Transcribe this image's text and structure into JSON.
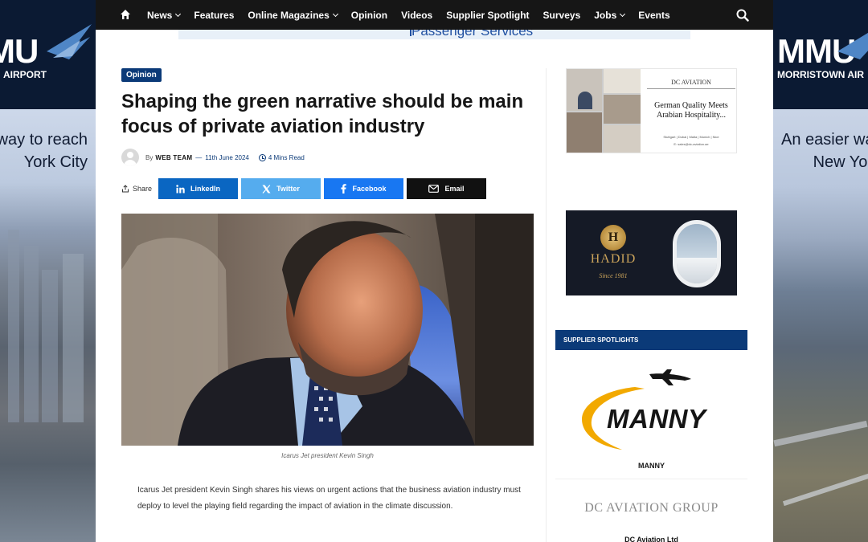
{
  "nav": {
    "items": [
      {
        "label": "News",
        "has_dropdown": true
      },
      {
        "label": "Features",
        "has_dropdown": false
      },
      {
        "label": "Online Magazines",
        "has_dropdown": true
      },
      {
        "label": "Opinion",
        "has_dropdown": false
      },
      {
        "label": "Videos",
        "has_dropdown": false
      },
      {
        "label": "Supplier Spotlight",
        "has_dropdown": false
      },
      {
        "label": "Surveys",
        "has_dropdown": false
      },
      {
        "label": "Jobs",
        "has_dropdown": true
      },
      {
        "label": "Events",
        "has_dropdown": false
      }
    ],
    "home_icon": "home-icon",
    "search_icon": "search-icon"
  },
  "header_banner": {
    "text": "Passenger Services"
  },
  "skins": {
    "left": {
      "brand": "MU",
      "sub": "AIRPORT",
      "tagline_1": "way to reach",
      "tagline_2": "York City"
    },
    "right": {
      "brand": "MMU",
      "sub": "MORRISTOWN AIR",
      "tagline_1": "An easier wa",
      "tagline_2": "New Yor"
    }
  },
  "article": {
    "category": "Opinion",
    "title": "Shaping the green narrative should be main focus of private aviation industry",
    "by": "By",
    "author": "WEB TEAM",
    "separator": "—",
    "date": "11th June 2024",
    "read_time": "4 Mins Read",
    "caption": "Icarus Jet president Kevin Singh",
    "lead": "Icarus Jet president Kevin Singh shares his views on urgent actions that the business aviation industry must deploy to level the playing field regarding the impact of aviation in the climate discussion."
  },
  "share": {
    "label": "Share",
    "buttons": [
      {
        "label": "LinkedIn",
        "color": "#0a66c2"
      },
      {
        "label": "Twitter",
        "color": "#55acee"
      },
      {
        "label": "Facebook",
        "color": "#1877f2"
      },
      {
        "label": "Email",
        "color": "#111111"
      }
    ]
  },
  "sidebar": {
    "ad_dc": {
      "brand": "DC AVIATION",
      "headline": "German Quality Meets Arabian Hospitality...",
      "cities": "Stuttgart | Dubai | Malta | Munich | Nice",
      "contact": "E: sales@dc-aviation.ae"
    },
    "ad_hadid": {
      "monogram": "H",
      "name": "HADID",
      "since": "Since 1981"
    },
    "spotlights_title": "SUPPLIER SPOTLIGHTS",
    "spotlights": [
      {
        "logo_text": "MANNY",
        "label": "MANNY"
      },
      {
        "logo_text": "DC AVIATION GROUP",
        "label": "DC Aviation Ltd"
      }
    ]
  },
  "colors": {
    "nav_bg": "#161616",
    "accent": "#0b3a78",
    "linkedin": "#0a66c2",
    "twitter": "#55acee",
    "facebook": "#1877f2",
    "email": "#111111",
    "manny_gold": "#f2a900"
  }
}
